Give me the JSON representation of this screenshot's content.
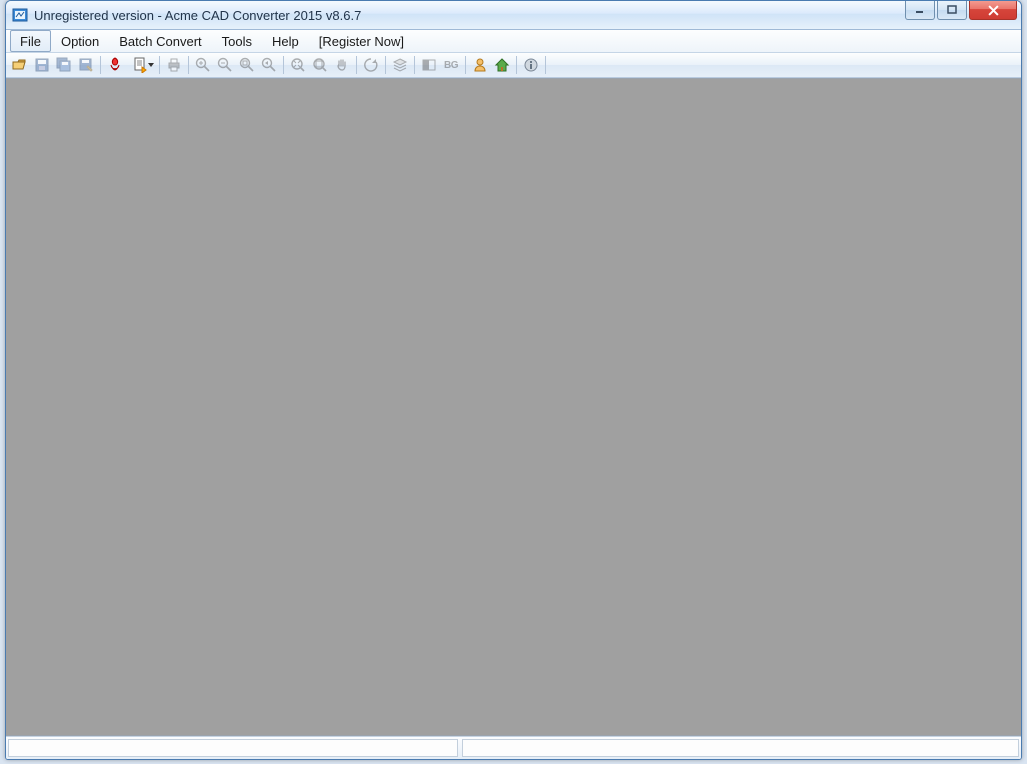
{
  "window": {
    "title": "Unregistered version - Acme CAD Converter 2015 v8.6.7"
  },
  "menu": {
    "items": [
      {
        "label": "File",
        "active": true
      },
      {
        "label": "Option",
        "active": false
      },
      {
        "label": "Batch Convert",
        "active": false
      },
      {
        "label": "Tools",
        "active": false
      },
      {
        "label": "Help",
        "active": false
      },
      {
        "label": "[Register Now]",
        "active": false
      }
    ]
  },
  "toolbar": {
    "buttons": [
      {
        "name": "open-icon",
        "enabled": true,
        "sep_after": false,
        "drop": false
      },
      {
        "name": "save-icon",
        "enabled": false,
        "sep_after": false,
        "drop": false
      },
      {
        "name": "save-all-icon",
        "enabled": false,
        "sep_after": false,
        "drop": false
      },
      {
        "name": "save-as-icon",
        "enabled": false,
        "sep_after": true,
        "drop": false
      },
      {
        "name": "pdf-icon",
        "enabled": true,
        "sep_after": false,
        "drop": false
      },
      {
        "name": "convert-icon",
        "enabled": true,
        "sep_after": true,
        "drop": true
      },
      {
        "name": "print-icon",
        "enabled": false,
        "sep_after": true,
        "drop": false
      },
      {
        "name": "zoom-in-icon",
        "enabled": false,
        "sep_after": false,
        "drop": false
      },
      {
        "name": "zoom-out-icon",
        "enabled": false,
        "sep_after": false,
        "drop": false
      },
      {
        "name": "zoom-window-icon",
        "enabled": false,
        "sep_after": false,
        "drop": false
      },
      {
        "name": "zoom-prev-icon",
        "enabled": false,
        "sep_after": true,
        "drop": false
      },
      {
        "name": "zoom-ext-icon",
        "enabled": false,
        "sep_after": false,
        "drop": false
      },
      {
        "name": "zoom-all-icon",
        "enabled": false,
        "sep_after": false,
        "drop": false
      },
      {
        "name": "pan-icon",
        "enabled": false,
        "sep_after": true,
        "drop": false
      },
      {
        "name": "regen-icon",
        "enabled": false,
        "sep_after": true,
        "drop": false
      },
      {
        "name": "layers-icon",
        "enabled": false,
        "sep_after": true,
        "drop": false
      },
      {
        "name": "bw-icon",
        "enabled": false,
        "sep_after": false,
        "drop": false
      },
      {
        "name": "bg-icon",
        "enabled": false,
        "sep_after": true,
        "drop": false
      },
      {
        "name": "register-icon",
        "enabled": true,
        "sep_after": false,
        "drop": false
      },
      {
        "name": "home-icon",
        "enabled": true,
        "sep_after": true,
        "drop": false
      },
      {
        "name": "about-icon",
        "enabled": true,
        "sep_after": true,
        "drop": false
      }
    ],
    "bg_label": "BG"
  },
  "statusbar": {
    "left_text": "",
    "right_text": ""
  }
}
